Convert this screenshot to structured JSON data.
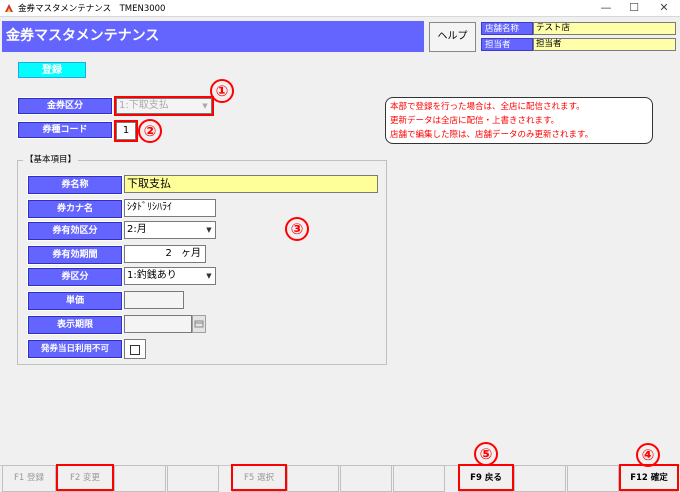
{
  "window": {
    "title": "金券マスタメンテナンス　TMEN3000",
    "minimize": "—",
    "maximize": "☐",
    "close": "✕"
  },
  "header": {
    "title": "金券マスタメンテナンス",
    "help_label": "ヘルプ",
    "store_label": "店舗名称",
    "store_value": "テスト店",
    "staff_label": "担当者",
    "staff_value": "担当者"
  },
  "register_label": "登録",
  "voucher_class": {
    "label": "金券区分",
    "value": "1:下取支払"
  },
  "type_code": {
    "label": "券種コード",
    "value": "1"
  },
  "note": {
    "lines": [
      "本部で登録を行った場合は、全店に配信されます。",
      "更新データは全店に配信・上書きされます。",
      "店舗で編集した際は、店舗データのみ更新されます。"
    ]
  },
  "basic": {
    "group_label": "【基本項目】",
    "name": {
      "label": "券名称",
      "value": "下取支払"
    },
    "kana": {
      "label": "券カナ名",
      "value": "ｼﾀﾄﾞﾘｼﾊﾗｲ"
    },
    "validity_class": {
      "label": "券有効区分",
      "value": "2:月"
    },
    "validity_period": {
      "label": "券有効期間",
      "value": "2",
      "unit": "ヶ月"
    },
    "ticket_class": {
      "label": "券区分",
      "value": "1:釣銭あり"
    },
    "unit_price": {
      "label": "単価",
      "value": ""
    },
    "display_deadline": {
      "label": "表示期限",
      "value": ""
    },
    "same_day": {
      "label": "発券当日利用不可"
    }
  },
  "annotations": [
    "①",
    "②",
    "③",
    "④",
    "⑤"
  ],
  "fkeys": {
    "f1": "F1 登録",
    "f2": "F2 変更",
    "f5": "F5 選択",
    "f9": "F9 戻る",
    "f12": "F12 確定"
  },
  "colors": {
    "header_blue": "#6464ff",
    "register_cyan": "#00ffff",
    "highlight_yellow": "#ffffaa",
    "annotation_red": "#ff0000"
  }
}
